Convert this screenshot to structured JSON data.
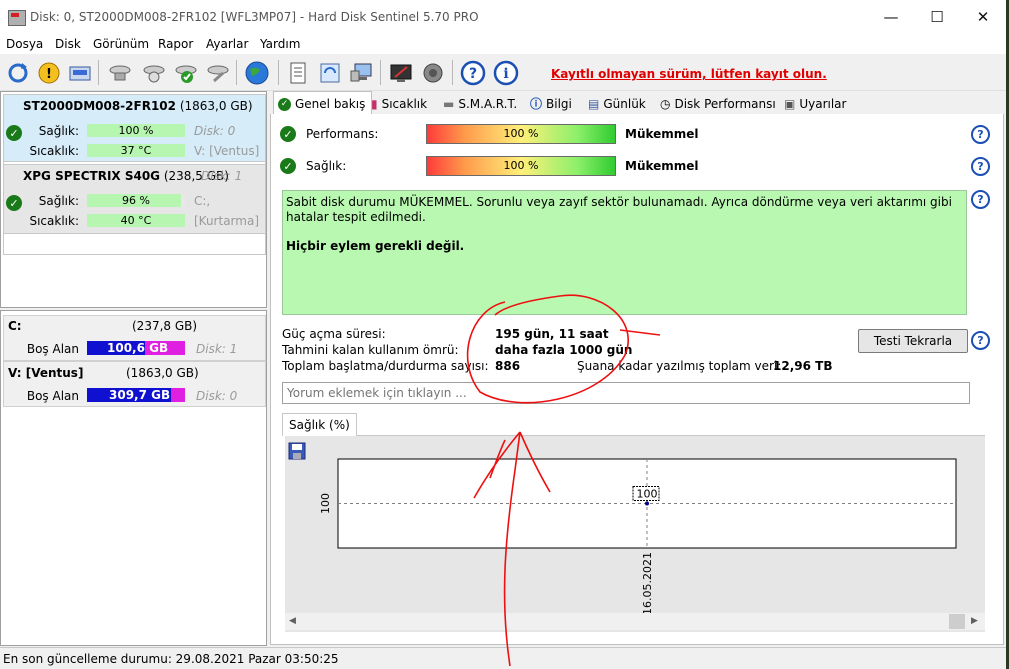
{
  "window": {
    "title": "Disk: 0, ST2000DM008-2FR102 [WFL3MP07]  -  Hard Disk Sentinel 5.70 PRO"
  },
  "menu": [
    "Dosya",
    "Disk",
    "Görünüm",
    "Rapor",
    "Ayarlar",
    "Yardım"
  ],
  "toolbar": {
    "registration_note": "Kayıtlı olmayan sürüm, lütfen kayıt olun."
  },
  "disks": [
    {
      "name": "ST2000DM008-2FR102",
      "size": "(1863,0 GB)",
      "disk_no": "Disk: 0",
      "health_label": "Sağlık:",
      "health_value": "100 %",
      "health_pct": 100,
      "health_extra": "Disk: 0",
      "temp_label": "Sıcaklık:",
      "temp_value": "37 °C",
      "temp_extra": "V: [Ventus]"
    },
    {
      "name": "XPG SPECTRIX S40G",
      "size": "(238,5 GB)",
      "disk_no": "Disk: 1",
      "health_label": "Sağlık:",
      "health_value": "96 %",
      "health_pct": 96,
      "health_extra": "C:,",
      "temp_label": "Sıcaklık:",
      "temp_value": "40 °C",
      "temp_extra": "[Kurtarma]"
    }
  ],
  "volumes": [
    {
      "name": "C:",
      "size": "(237,8 GB)",
      "free_label": "Boş Alan",
      "free_value": "100,6",
      "free_unit": "GB",
      "disk": "Disk: 1"
    },
    {
      "name": "V: [Ventus]",
      "size": "(1863,0 GB)",
      "free_label": "Boş Alan",
      "free_value": "309,7 GB",
      "disk": "Disk: 0"
    }
  ],
  "tabs": [
    "Genel bakış",
    "Sıcaklık",
    "S.M.A.R.T.",
    "Bilgi",
    "Günlük",
    "Disk Performansı",
    "Uyarılar"
  ],
  "overview": {
    "performance_label": "Performans:",
    "performance_value": "100 %",
    "performance_status": "Mükemmel",
    "health_label": "Sağlık:",
    "health_value": "100 %",
    "health_status": "Mükemmel",
    "description": "Sabit disk durumu MÜKEMMEL. Sorunlu veya zayıf sektör bulunamadı. Ayrıca döndürme veya veri aktarımı gibi hatalar tespit edilmedi.",
    "action": "Hiçbir eylem gerekli değil.",
    "power_on_label": "Güç açma süresi:",
    "power_on_value": "195 gün, 11 saat",
    "lifetime_label": "Tahmini kalan kullanım ömrü:",
    "lifetime_value": "daha fazla 1000 gün",
    "start_stop_label": "Toplam başlatma/durdurma sayısı:",
    "start_stop_value": "886",
    "written_label": "Şuana kadar yazılmış toplam veri:",
    "written_value": "12,96 TB",
    "retest_button": "Testi Tekrarla",
    "comment_placeholder": "Yorum eklemek için tıklayın ..."
  },
  "chart_tab": "Sağlık (%)",
  "chart_data": {
    "type": "line",
    "x": [
      "16.05.2021"
    ],
    "series": [
      {
        "values": [
          100
        ]
      }
    ],
    "ytick": "100",
    "data_label": "100"
  },
  "status": {
    "text": "En son güncelleme durumu: 29.08.2021 Pazar 03:50:25"
  }
}
